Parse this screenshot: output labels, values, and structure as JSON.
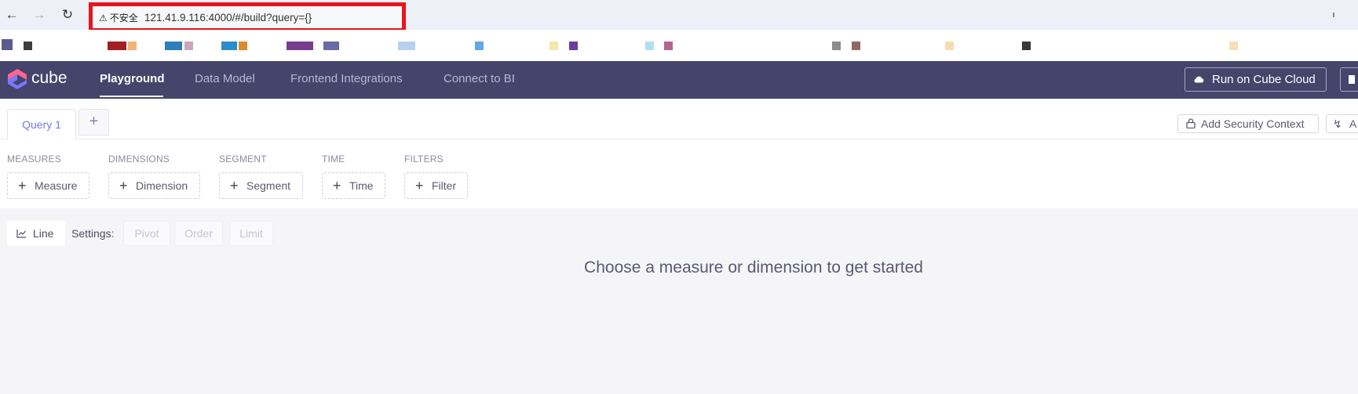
{
  "browser": {
    "back_icon": "arrow-left-icon",
    "forward_icon": "arrow-right-icon",
    "reload_icon": "reload-icon",
    "security_label": "不安全",
    "url": "121.41.9.116:4000/#/build?query={}",
    "highlight_color": "#e8141c"
  },
  "header": {
    "logo_text": "cube",
    "nav": [
      "Playground",
      "Data Model",
      "Frontend Integrations",
      "Connect to BI"
    ],
    "cloud_button": "Run on Cube Cloud",
    "bg_color": "#45446b"
  },
  "tabs": {
    "query_tab": "Query 1",
    "add_tab": "+",
    "security_context_button": "Add Security Context",
    "edge_button_text": "A"
  },
  "members": {
    "groups": [
      {
        "label": "MEASURES",
        "button": "Measure"
      },
      {
        "label": "DIMENSIONS",
        "button": "Dimension"
      },
      {
        "label": "SEGMENT",
        "button": "Segment"
      },
      {
        "label": "TIME",
        "button": "Time"
      },
      {
        "label": "FILTERS",
        "button": "Filter"
      }
    ]
  },
  "settings": {
    "chart_type": "Line",
    "label": "Settings:",
    "buttons": [
      "Pivot",
      "Order",
      "Limit"
    ]
  },
  "empty_state": "Choose a measure or dimension to get started",
  "accent_color": "#7a77e6"
}
